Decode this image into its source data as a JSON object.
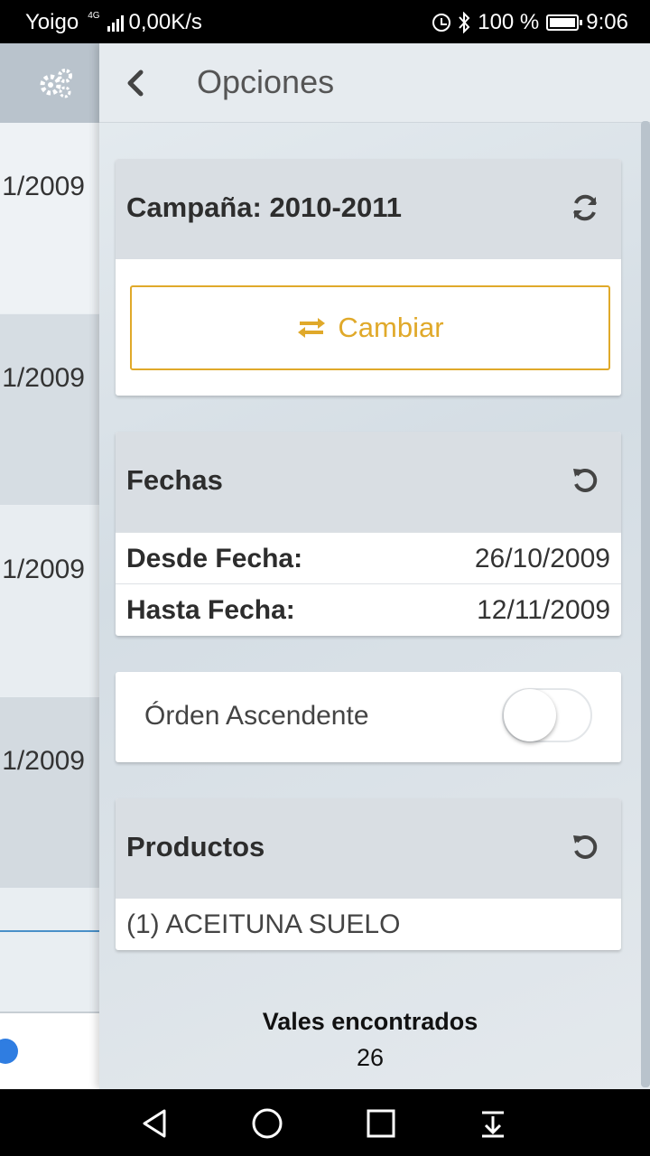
{
  "status_bar": {
    "carrier": "Yoigo",
    "network_tag": "4G",
    "speed": "0,00K/s",
    "battery": "100 %",
    "time": "9:06"
  },
  "background_list": {
    "dates": [
      "1/2009",
      "1/2009",
      "1/2009",
      "1/2009"
    ]
  },
  "drawer": {
    "title": "Opciones",
    "campaign": {
      "label": "Campaña: 2010-2011",
      "change_button": "Cambiar"
    },
    "dates": {
      "title": "Fechas",
      "from_label": "Desde Fecha:",
      "from_value": "26/10/2009",
      "to_label": "Hasta Fecha:",
      "to_value": "12/11/2009"
    },
    "order": {
      "label": "Órden Ascendente",
      "enabled": false
    },
    "products": {
      "title": "Productos",
      "items": [
        "(1) ACEITUNA SUELO"
      ]
    },
    "found": {
      "label": "Vales encontrados",
      "count": "26"
    }
  },
  "colors": {
    "accent": "#e0a92a",
    "header_gray": "#d9dee3",
    "link_blue": "#4a90c8"
  }
}
